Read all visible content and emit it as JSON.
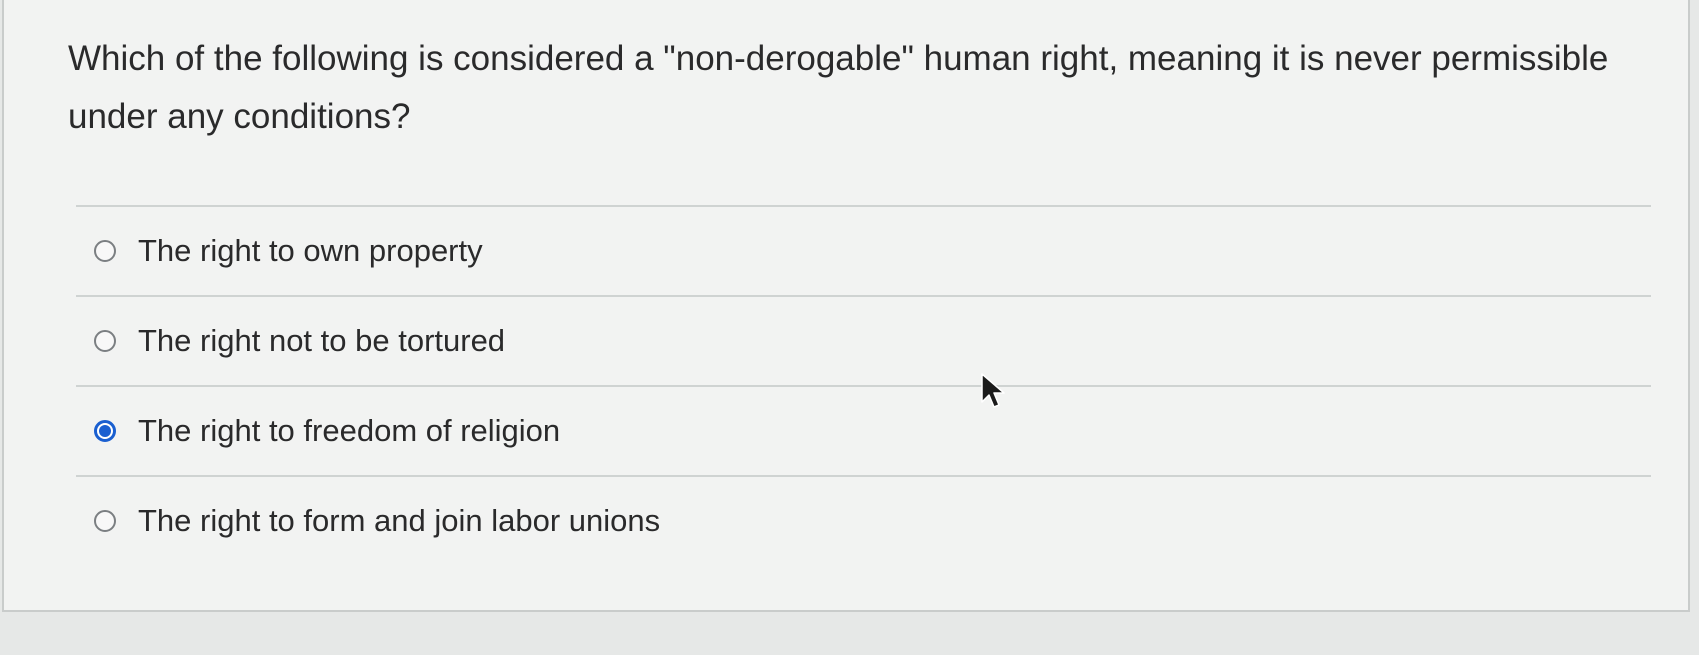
{
  "question": {
    "text": "Which of the following is considered a \"non-derogable\" human right, meaning it is never permissible under any conditions?"
  },
  "options": [
    {
      "label": "The right to own property",
      "selected": false
    },
    {
      "label": "The right not to be tortured",
      "selected": false
    },
    {
      "label": "The right to freedom of religion",
      "selected": true
    },
    {
      "label": "The right to form and join labor unions",
      "selected": false
    }
  ],
  "colors": {
    "accent": "#1a5fd0",
    "text": "#2a2a2b",
    "divider": "#cfd3d2"
  },
  "icons": {
    "cursor": "mouse-pointer-icon"
  }
}
